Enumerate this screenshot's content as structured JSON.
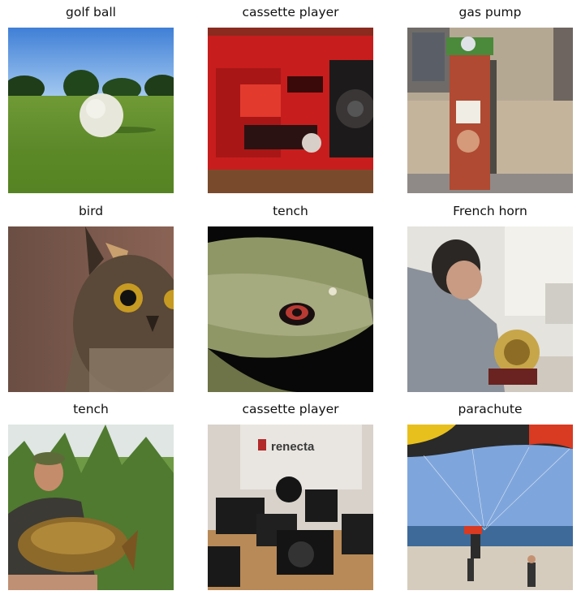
{
  "grid": {
    "items": [
      {
        "label": "golf ball",
        "image": "golf-ball-photo"
      },
      {
        "label": "cassette player",
        "image": "red-boombox-photo"
      },
      {
        "label": "gas pump",
        "image": "vintage-gas-pump-photo"
      },
      {
        "label": "bird",
        "image": "owl-photo"
      },
      {
        "label": "tench",
        "image": "fish-closeup-photo"
      },
      {
        "label": "French horn",
        "image": "man-with-horn-photo"
      },
      {
        "label": "tench",
        "image": "man-holding-fish-photo"
      },
      {
        "label": "cassette player",
        "image": "cameras-on-table-photo",
        "sign_text": "renecta"
      },
      {
        "label": "parachute",
        "image": "parachute-beach-photo"
      }
    ]
  }
}
